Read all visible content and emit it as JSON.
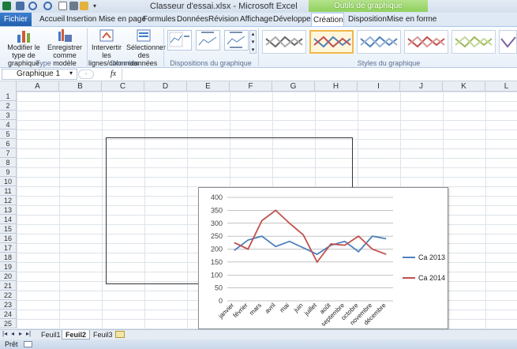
{
  "window": {
    "title": "Classeur d'essai.xlsx - Microsoft Excel",
    "contextual_header": "Outils de graphique"
  },
  "ribbon_tabs": {
    "file": "Fichier",
    "items": [
      "Accueil",
      "Insertion",
      "Mise en page",
      "Formules",
      "Données",
      "Révision",
      "Affichage",
      "Développeur",
      "Création",
      "Disposition",
      "Mise en forme"
    ],
    "active": "Création"
  },
  "ribbon": {
    "type_group": {
      "label": "Type",
      "change_type": "Modifier le type de graphique",
      "save_template": "Enregistrer comme modèle"
    },
    "data_group": {
      "label": "Données",
      "switch": "Intervertir les lignes/colonnes",
      "select": "Sélectionner des données"
    },
    "layouts_group": {
      "label": "Dispositions du graphique"
    },
    "styles_group": {
      "label": "Styles du graphique"
    }
  },
  "formula_bar": {
    "name_box": "Graphique 1",
    "fx": "fx",
    "value": ""
  },
  "columns": [
    "A",
    "B",
    "C",
    "D",
    "E",
    "F",
    "G",
    "H",
    "I",
    "J",
    "K",
    "L"
  ],
  "rows": [
    "1",
    "2",
    "3",
    "4",
    "5",
    "6",
    "7",
    "8",
    "9",
    "10",
    "11",
    "12",
    "13",
    "14",
    "15",
    "16",
    "17",
    "18",
    "19",
    "20",
    "21",
    "22",
    "23",
    "24",
    "25"
  ],
  "sheets": {
    "items": [
      "Feuil1",
      "Feuil2",
      "Feuil3"
    ],
    "active": "Feuil2"
  },
  "status": {
    "text": "Prêt"
  },
  "colors": {
    "series1": "#4f81bd",
    "series2": "#c0504d"
  },
  "chart_data": {
    "type": "line",
    "categories": [
      "janvier",
      "février",
      "mars",
      "avril",
      "mai",
      "juin",
      "juillet",
      "août",
      "septembre",
      "octobre",
      "novembre",
      "décembre"
    ],
    "series": [
      {
        "name": "Ca 2013",
        "values": [
          195,
          235,
          250,
          210,
          230,
          205,
          180,
          215,
          230,
          190,
          250,
          240
        ]
      },
      {
        "name": "Ca 2014",
        "values": [
          225,
          200,
          310,
          350,
          300,
          255,
          150,
          220,
          215,
          250,
          200,
          180
        ]
      }
    ],
    "ylim": [
      0,
      400
    ],
    "yticks": [
      0,
      50,
      100,
      150,
      200,
      250,
      300,
      350,
      400
    ],
    "grid": true,
    "legend": "right"
  }
}
